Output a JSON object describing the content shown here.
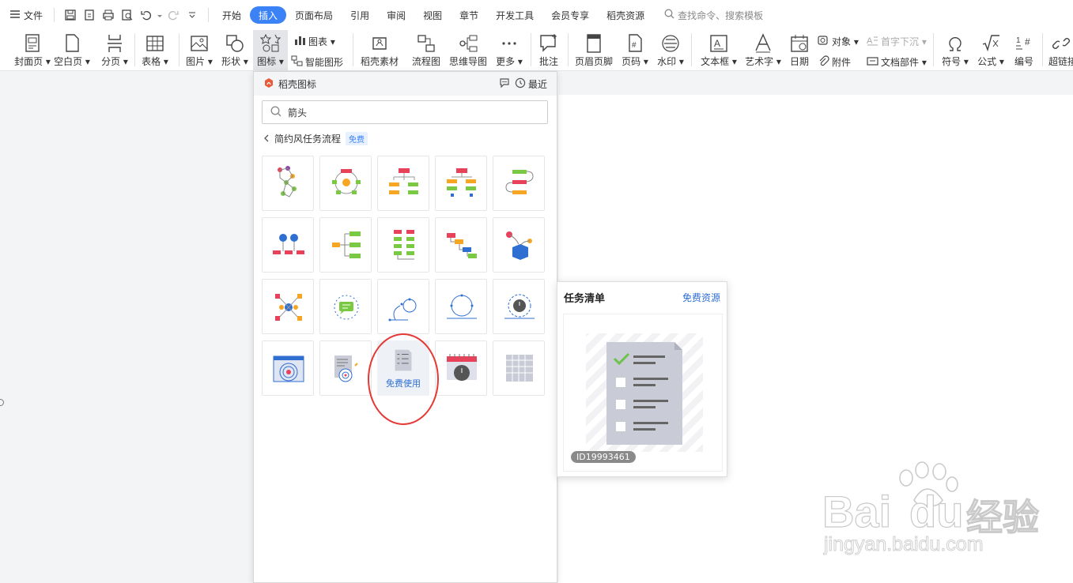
{
  "menubar": {
    "file_label": "文件",
    "tabs": [
      "开始",
      "插入",
      "页面布局",
      "引用",
      "审阅",
      "视图",
      "章节",
      "开发工具",
      "会员专享",
      "稻壳资源"
    ],
    "active_tab": 1,
    "search_label": "查找命令、搜索模板"
  },
  "ribbon": {
    "big": [
      {
        "label": "封面页",
        "arrow": true
      },
      {
        "label": "空白页",
        "arrow": true
      },
      {
        "label": "分页",
        "arrow": true
      },
      {
        "label": "表格",
        "arrow": true
      },
      {
        "label": "图片",
        "arrow": true
      },
      {
        "label": "形状",
        "arrow": true
      },
      {
        "label": "图标",
        "arrow": true
      },
      {
        "label": "稻壳素材"
      },
      {
        "label": "流程图"
      },
      {
        "label": "思维导图"
      },
      {
        "label": "更多",
        "arrow": true
      },
      {
        "label": "批注"
      },
      {
        "label": "页眉页脚"
      },
      {
        "label": "页码",
        "arrow": true
      },
      {
        "label": "水印",
        "arrow": true
      },
      {
        "label": "文本框",
        "arrow": true
      },
      {
        "label": "艺术字",
        "arrow": true
      },
      {
        "label": "日期"
      },
      {
        "label": "符号",
        "arrow": true
      },
      {
        "label": "公式",
        "arrow": true
      },
      {
        "label": "编号"
      },
      {
        "label": "超链接"
      }
    ],
    "small": {
      "chart": "图表",
      "smart_graphic": "智能图形",
      "object": "对象",
      "attachment": "附件",
      "drop_cap": "首字下沉",
      "doc_parts": "文档部件"
    }
  },
  "panel": {
    "title": "稻壳图标",
    "recent": "最近",
    "search_value": "箭头",
    "crumb": "简约风任务流程",
    "free_badge": "免费",
    "use_label": "免费使用"
  },
  "preview": {
    "title": "任务清单",
    "link": "免费资源",
    "id": "ID19993461"
  },
  "watermark": {
    "brand": "Bai",
    "brand2": "du",
    "cn": "经验",
    "url": "jingyan.baidu.com"
  },
  "colors": {
    "accent": "#3b82f6",
    "highlight_circle": "#e53935"
  }
}
